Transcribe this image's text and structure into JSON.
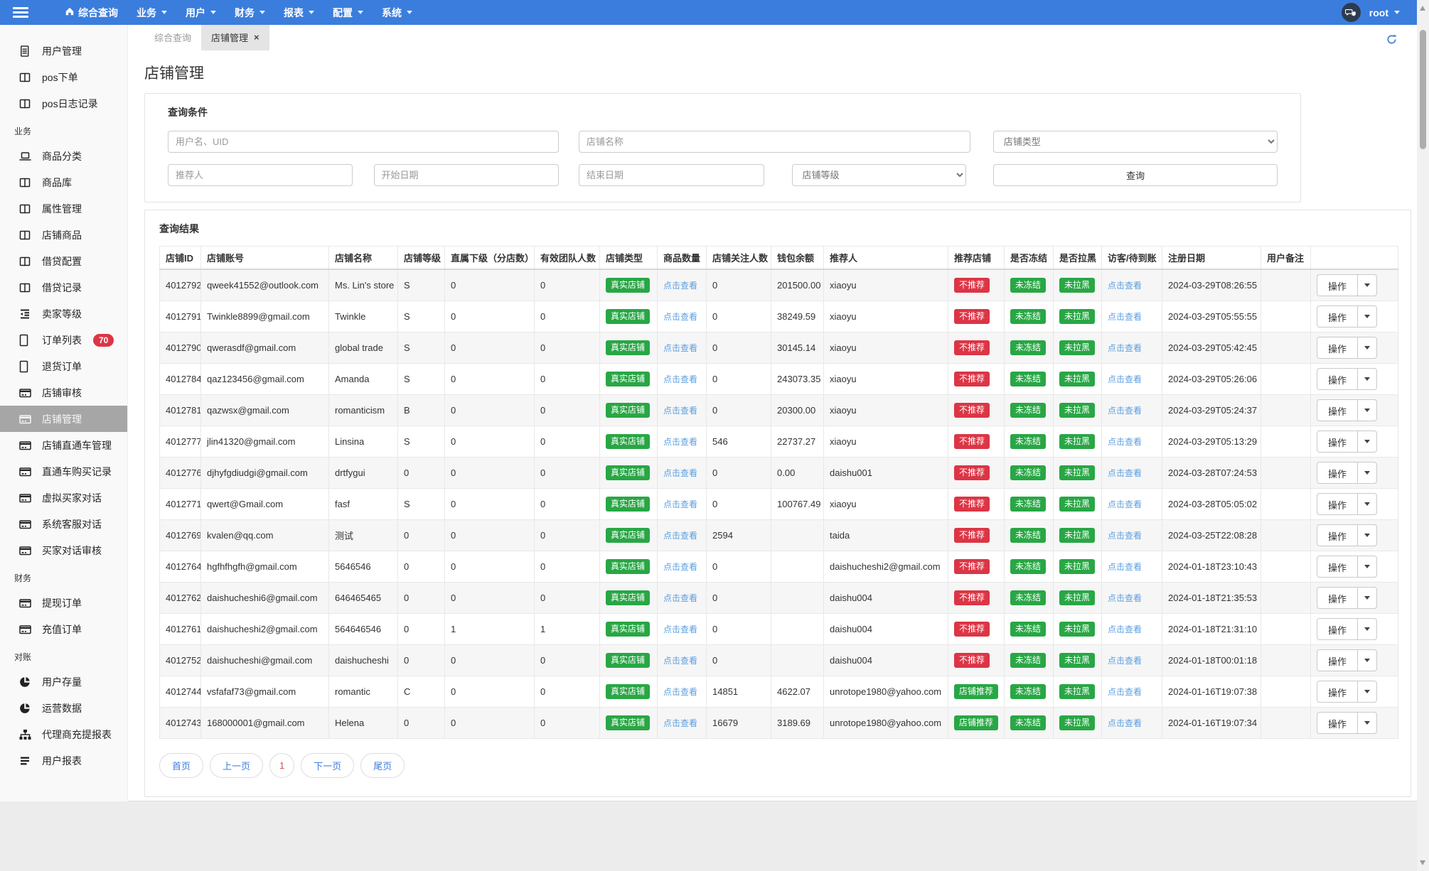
{
  "colors": {
    "navbar_bg": "#3b7ddd",
    "badge_green": "#28a745",
    "badge_red": "#dc3545",
    "link_blue": "#5c9fe0",
    "page_current_red": "#c9534a",
    "active_sidebar_bg": "#a6a6a6"
  },
  "navbar": {
    "home_item": {
      "label": "综合查询",
      "icon": "home-icon"
    },
    "menus": [
      {
        "label": "业务"
      },
      {
        "label": "用户"
      },
      {
        "label": "财务"
      },
      {
        "label": "报表"
      },
      {
        "label": "配置"
      },
      {
        "label": "系统"
      }
    ],
    "chat_icon": "chat-bubbles-icon",
    "user": "root"
  },
  "sidebar": {
    "groups": [
      {
        "header": "",
        "items": [
          {
            "label": "用户管理",
            "icon": "file-text-icon"
          },
          {
            "label": "pos下单",
            "icon": "columns-icon"
          },
          {
            "label": "pos日志记录",
            "icon": "columns-icon"
          }
        ]
      },
      {
        "header": "业务",
        "items": [
          {
            "label": "商品分类",
            "icon": "laptop-icon"
          },
          {
            "label": "商品库",
            "icon": "columns-icon"
          },
          {
            "label": "属性管理",
            "icon": "columns-icon"
          },
          {
            "label": "店铺商品",
            "icon": "columns-icon"
          },
          {
            "label": "借贷配置",
            "icon": "columns-icon"
          },
          {
            "label": "借贷记录",
            "icon": "columns-icon"
          },
          {
            "label": "卖家等级",
            "icon": "outdent-icon"
          },
          {
            "label": "订单列表",
            "icon": "file-icon",
            "badge": "70"
          },
          {
            "label": "退货订单",
            "icon": "file-icon"
          },
          {
            "label": "店铺审核",
            "icon": "credit-card-icon"
          },
          {
            "label": "店铺管理",
            "icon": "credit-card-icon",
            "active": true
          },
          {
            "label": "店铺直通车管理",
            "icon": "credit-card-icon"
          },
          {
            "label": "直通车购买记录",
            "icon": "credit-card-icon"
          },
          {
            "label": "虚拟买家对话",
            "icon": "credit-card-icon"
          },
          {
            "label": "系统客服对话",
            "icon": "credit-card-icon"
          },
          {
            "label": "买家对话审核",
            "icon": "credit-card-icon"
          }
        ]
      },
      {
        "header": "财务",
        "items": [
          {
            "label": "提现订单",
            "icon": "credit-card-icon"
          },
          {
            "label": "充值订单",
            "icon": "credit-card-icon"
          }
        ]
      },
      {
        "header": "对账",
        "items": [
          {
            "label": "用户存量",
            "icon": "pie-chart-icon"
          },
          {
            "label": "运营数据",
            "icon": "pie-chart-icon"
          },
          {
            "label": "代理商充提报表",
            "icon": "sitemap-icon"
          },
          {
            "label": "用户报表",
            "icon": "bars-icon"
          }
        ]
      }
    ]
  },
  "tabs": [
    {
      "label": "综合查询",
      "active": false,
      "closable": false
    },
    {
      "label": "店铺管理",
      "active": true,
      "closable": true,
      "close_glyph": "×"
    }
  ],
  "page_title": "店铺管理",
  "filter": {
    "title": "查询条件",
    "row1": [
      {
        "kind": "input",
        "placeholder": "用户名、UID",
        "name": "username-uid-input"
      },
      {
        "kind": "input",
        "placeholder": "店铺名称",
        "name": "shop-name-input"
      },
      {
        "kind": "select",
        "label": "店铺类型",
        "name": "shop-type-select"
      }
    ],
    "row2": [
      {
        "kind": "input",
        "placeholder": "推荐人",
        "name": "referrer-input"
      },
      {
        "kind": "input",
        "placeholder": "开始日期",
        "name": "start-date-input"
      },
      {
        "kind": "input",
        "placeholder": "结束日期",
        "name": "end-date-input"
      },
      {
        "kind": "select",
        "label": "店铺等级",
        "name": "shop-level-select"
      },
      {
        "kind": "button",
        "label": "查询",
        "name": "search-button"
      }
    ]
  },
  "results": {
    "title": "查询结果",
    "columns": [
      "店铺ID",
      "店铺账号",
      "店铺名称",
      "店铺等级",
      "直属下级（分店数）",
      "有效团队人数",
      "店铺类型",
      "商品数量",
      "店铺关注人数",
      "钱包余额",
      "推荐人",
      "推荐店铺",
      "是否冻结",
      "是否拉黑",
      "访客/待到账",
      "注册日期",
      "用户备注",
      ""
    ],
    "shared": {
      "shop_type_badge": "真实店铺",
      "goods_link": "点击查看",
      "visitors_link": "点击查看",
      "frozen_badge": "未冻结",
      "blacklist_badge": "未拉黑",
      "action_label": "操作"
    },
    "rows": [
      {
        "id": "4012792",
        "account": "qweek41552@outlook.com",
        "name": "Ms. Lin's store",
        "level": "S",
        "subs": "0",
        "team": "0",
        "followers": "0",
        "balance": "201500.00",
        "referrer": "xiaoyu",
        "recommend": "不推荐",
        "date": "2024-03-29T08:26:55",
        "remark": ""
      },
      {
        "id": "4012791",
        "account": "Twinkle8899@gmail.com",
        "name": "Twinkle",
        "level": "S",
        "subs": "0",
        "team": "0",
        "followers": "0",
        "balance": "38249.59",
        "referrer": "xiaoyu",
        "recommend": "不推荐",
        "date": "2024-03-29T05:55:55",
        "remark": ""
      },
      {
        "id": "4012790",
        "account": "qwerasdf@gmail.com",
        "name": "global trade",
        "level": "S",
        "subs": "0",
        "team": "0",
        "followers": "0",
        "balance": "30145.14",
        "referrer": "xiaoyu",
        "recommend": "不推荐",
        "date": "2024-03-29T05:42:45",
        "remark": ""
      },
      {
        "id": "4012784",
        "account": "qaz123456@gmail.com",
        "name": "Amanda",
        "level": "S",
        "subs": "0",
        "team": "0",
        "followers": "0",
        "balance": "243073.35",
        "referrer": "xiaoyu",
        "recommend": "不推荐",
        "date": "2024-03-29T05:26:06",
        "remark": ""
      },
      {
        "id": "4012781",
        "account": "qazwsx@gmail.com",
        "name": "romanticism",
        "level": "B",
        "subs": "0",
        "team": "0",
        "followers": "0",
        "balance": "20300.00",
        "referrer": "xiaoyu",
        "recommend": "不推荐",
        "date": "2024-03-29T05:24:37",
        "remark": ""
      },
      {
        "id": "4012777",
        "account": "jlin41320@gmail.com",
        "name": "Linsina",
        "level": "S",
        "subs": "0",
        "team": "0",
        "followers": "546",
        "balance": "22737.27",
        "referrer": "xiaoyu",
        "recommend": "不推荐",
        "date": "2024-03-29T05:13:29",
        "remark": ""
      },
      {
        "id": "4012776",
        "account": "djhyfgdiudgi@gmail.com",
        "name": "drtfygui",
        "level": "0",
        "subs": "0",
        "team": "0",
        "followers": "0",
        "balance": "0.00",
        "referrer": "daishu001",
        "recommend": "不推荐",
        "date": "2024-03-28T07:24:53",
        "remark": ""
      },
      {
        "id": "4012771",
        "account": "qwert@Gmail.com",
        "name": "fasf",
        "level": "S",
        "subs": "0",
        "team": "0",
        "followers": "0",
        "balance": "100767.49",
        "referrer": "xiaoyu",
        "recommend": "不推荐",
        "date": "2024-03-28T05:05:02",
        "remark": ""
      },
      {
        "id": "4012769",
        "account": "kvalen@qq.com",
        "name": "测试",
        "level": "0",
        "subs": "0",
        "team": "0",
        "followers": "2594",
        "balance": "",
        "referrer": "taida",
        "recommend": "不推荐",
        "date": "2024-03-25T22:08:28",
        "remark": ""
      },
      {
        "id": "4012764",
        "account": "hgfhfhgfh@gmail.com",
        "name": "5646546",
        "level": "0",
        "subs": "0",
        "team": "0",
        "followers": "0",
        "balance": "",
        "referrer": "daishucheshi2@gmail.com",
        "recommend": "不推荐",
        "date": "2024-01-18T23:10:43",
        "remark": ""
      },
      {
        "id": "4012762",
        "account": "daishucheshi6@gmail.com",
        "name": "646465465",
        "level": "0",
        "subs": "0",
        "team": "0",
        "followers": "0",
        "balance": "",
        "referrer": "daishu004",
        "recommend": "不推荐",
        "date": "2024-01-18T21:35:53",
        "remark": ""
      },
      {
        "id": "4012761",
        "account": "daishucheshi2@gmail.com",
        "name": "564646546",
        "level": "0",
        "subs": "1",
        "team": "1",
        "followers": "0",
        "balance": "",
        "referrer": "daishu004",
        "recommend": "不推荐",
        "date": "2024-01-18T21:31:10",
        "remark": ""
      },
      {
        "id": "4012752",
        "account": "daishucheshi@gmail.com",
        "name": "daishucheshi",
        "level": "0",
        "subs": "0",
        "team": "0",
        "followers": "0",
        "balance": "",
        "referrer": "daishu004",
        "recommend": "不推荐",
        "date": "2024-01-18T00:01:18",
        "remark": ""
      },
      {
        "id": "4012744",
        "account": "vsfafaf73@gmail.com",
        "name": "romantic",
        "level": "C",
        "subs": "0",
        "team": "0",
        "followers": "14851",
        "balance": "4622.07",
        "referrer": "unrotope1980@yahoo.com",
        "recommend": "店铺推荐",
        "date": "2024-01-16T19:07:38",
        "remark": ""
      },
      {
        "id": "4012743",
        "account": "168000001@gmail.com",
        "name": "Helena",
        "level": "0",
        "subs": "0",
        "team": "0",
        "followers": "16679",
        "balance": "3189.69",
        "referrer": "unrotope1980@yahoo.com",
        "recommend": "店铺推荐",
        "date": "2024-01-16T19:07:34",
        "remark": ""
      }
    ]
  },
  "pagination": [
    {
      "label": "首页"
    },
    {
      "label": "上一页"
    },
    {
      "label": "1",
      "current": true
    },
    {
      "label": "下一页"
    },
    {
      "label": "尾页"
    }
  ]
}
